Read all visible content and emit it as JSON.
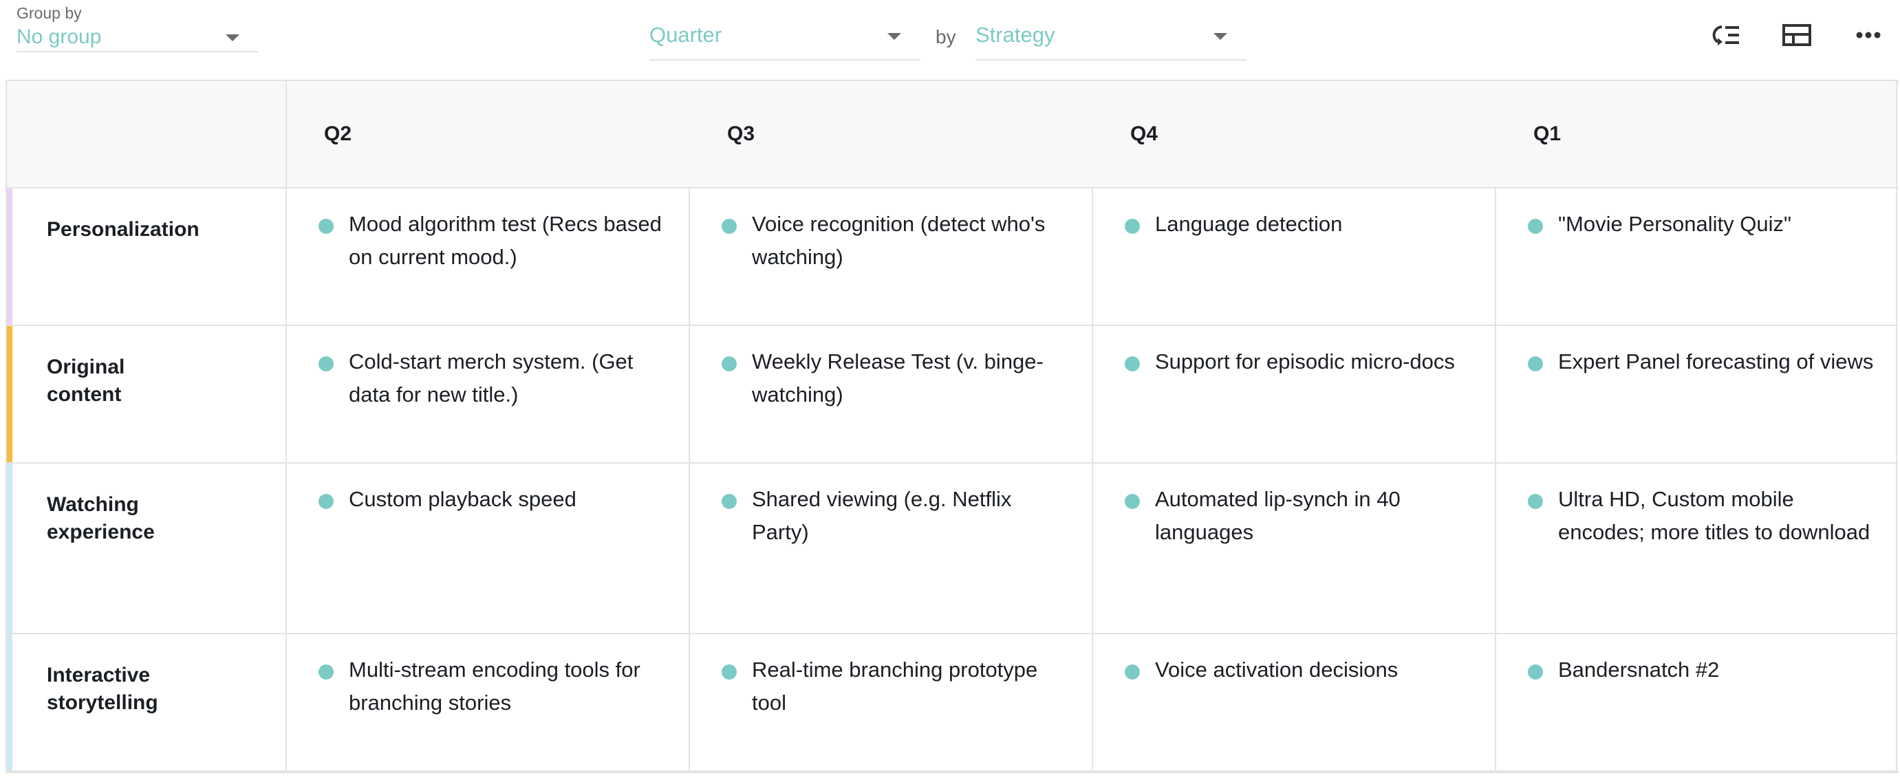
{
  "toolbar": {
    "group_by": {
      "label": "Group by",
      "value": "No group"
    },
    "columns_field": {
      "value": "Quarter"
    },
    "by_label": "by",
    "rows_field": {
      "value": "Strategy"
    },
    "icons": {
      "reorder": "reorder-icon",
      "layout": "layout-icon",
      "more": "more-options-icon"
    }
  },
  "colors": {
    "accent": "#7ccac6",
    "dot": "#7ccac6",
    "border": "#e3e3e3",
    "header_bg": "#f8f8f8"
  },
  "board": {
    "columns": [
      {
        "label": "Q2"
      },
      {
        "label": "Q3"
      },
      {
        "label": "Q4"
      },
      {
        "label": "Q1"
      }
    ],
    "lanes": [
      {
        "title": "Personalization",
        "color": "#ebd3f7",
        "cells": [
          "Mood algorithm test (Recs based on current mood.)",
          "Voice recognition (detect who's watching)",
          "Language detection",
          "\"Movie Personality Quiz\""
        ]
      },
      {
        "title": "Original content",
        "color": "#f6b941",
        "cells": [
          "Cold-start merch system. (Get data for new title.)",
          "Weekly Release Test (v. binge-watching)",
          "Support for episodic micro-docs",
          "Expert Panel forecasting of views"
        ]
      },
      {
        "title": "Watching experience",
        "color": "#cde9f3",
        "cells": [
          "Custom playback speed",
          "Shared viewing (e.g. Netflix Party)",
          "Automated lip-synch in 40 languages",
          "Ultra HD, Custom mobile encodes; more titles to download"
        ]
      },
      {
        "title": "Interactive storytelling",
        "color": "#cde9f3",
        "cells": [
          "Multi-stream encoding tools for branching stories",
          "Real-time branching prototype tool",
          "Voice activation decisions",
          "Bandersnatch #2"
        ]
      }
    ]
  }
}
